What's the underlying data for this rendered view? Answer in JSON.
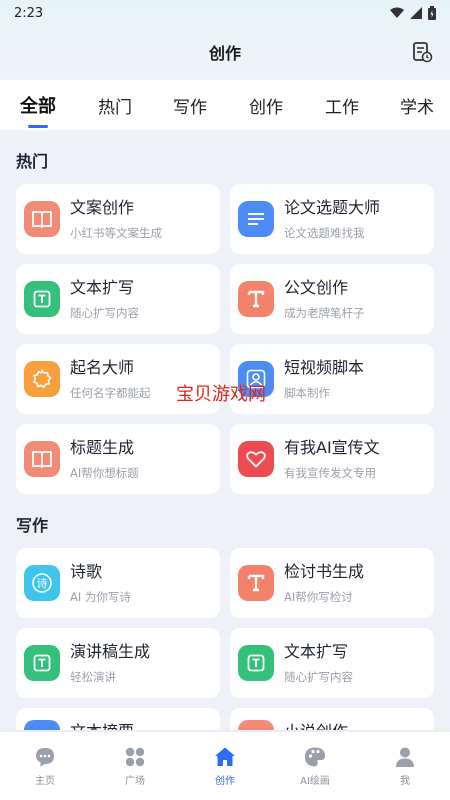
{
  "status": {
    "time": "2:23"
  },
  "header": {
    "title": "创作"
  },
  "tabs": [
    "全部",
    "热门",
    "写作",
    "创作",
    "工作",
    "学术"
  ],
  "sections": [
    {
      "title": "热门",
      "items": [
        {
          "name": "文案创作",
          "desc": "小红书等文案生成",
          "icon": "book-icon",
          "color": "#f28a78"
        },
        {
          "name": "论文选题大师",
          "desc": "论文选题难找我",
          "icon": "document-lines-icon",
          "color": "#4d8cf5"
        },
        {
          "name": "文本扩写",
          "desc": "随心扩写内容",
          "icon": "text-t-icon",
          "color": "#34c07a"
        },
        {
          "name": "公文创作",
          "desc": "成为老牌笔杆子",
          "icon": "letter-t-icon",
          "color": "#f2826a"
        },
        {
          "name": "起名大师",
          "desc": "任何名字都能起",
          "icon": "badge-icon",
          "color": "#f5a03c"
        },
        {
          "name": "短视频脚本",
          "desc": "脚本制作",
          "icon": "person-icon",
          "color": "#4d8cf5"
        },
        {
          "name": "标题生成",
          "desc": "AI帮你想标题",
          "icon": "book-icon",
          "color": "#f28a78"
        },
        {
          "name": "有我AI宣传文",
          "desc": "有我宣传发文专用",
          "icon": "heart-icon",
          "color": "#ee4b50"
        }
      ]
    },
    {
      "title": "写作",
      "items": [
        {
          "name": "诗歌",
          "desc": "AI 为你写诗",
          "icon": "poem-icon",
          "color": "#3fc4ec"
        },
        {
          "name": "检讨书生成",
          "desc": "AI帮你写检讨",
          "icon": "letter-t-icon",
          "color": "#f2826a"
        },
        {
          "name": "演讲稿生成",
          "desc": "轻松演讲",
          "icon": "text-t-icon",
          "color": "#34c07a"
        },
        {
          "name": "文本扩写",
          "desc": "随心扩写内容",
          "icon": "text-t-icon",
          "color": "#34c07a"
        },
        {
          "name": "文本摘要",
          "desc": "",
          "icon": "document-lines-icon",
          "color": "#4d8cf5"
        },
        {
          "name": "小说创作",
          "desc": "",
          "icon": "book-icon",
          "color": "#f28a78"
        }
      ]
    }
  ],
  "watermark": "宝贝游戏网",
  "nav": [
    {
      "label": "主页",
      "icon": "chat-icon"
    },
    {
      "label": "广场",
      "icon": "grid-icon"
    },
    {
      "label": "创作",
      "icon": "home-icon"
    },
    {
      "label": "AI绘画",
      "icon": "palette-icon"
    },
    {
      "label": "我",
      "icon": "user-icon"
    }
  ],
  "colors": {
    "accent": "#2f6cf6"
  }
}
